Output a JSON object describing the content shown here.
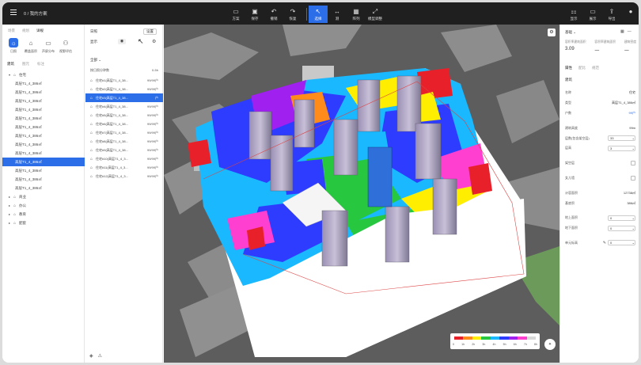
{
  "app": {
    "crumb": "0 / 我的方案"
  },
  "toolbar": {
    "groups": [
      {
        "items": [
          {
            "icon": "folder-icon",
            "glyph": "▭",
            "label": "方案"
          },
          {
            "icon": "save-icon",
            "glyph": "▣",
            "label": "保存"
          },
          {
            "icon": "undo-icon",
            "glyph": "↶",
            "label": "撤销"
          },
          {
            "icon": "redo-icon",
            "glyph": "↷",
            "label": "恢复"
          }
        ]
      },
      {
        "items": [
          {
            "icon": "cursor-icon",
            "glyph": "↖",
            "label": "选择",
            "active": true
          },
          {
            "icon": "measure-icon",
            "glyph": "↔",
            "label": "测"
          },
          {
            "icon": "array-icon",
            "glyph": "▦",
            "label": "阵列"
          },
          {
            "icon": "scale-icon",
            "glyph": "⤢",
            "label": "模型调整"
          }
        ]
      }
    ],
    "right": [
      {
        "icon": "display-icon",
        "glyph": "⚏",
        "label": "显示"
      },
      {
        "icon": "monitor-icon",
        "glyph": "▭",
        "label": "展示"
      },
      {
        "icon": "export-icon",
        "glyph": "⇪",
        "label": "导出"
      },
      {
        "icon": "user-icon",
        "glyph": "●",
        "label": ""
      }
    ]
  },
  "left": {
    "tabs": [
      "场景",
      "规划",
      "详规"
    ],
    "modes": [
      {
        "label": "日照",
        "icon": "sun-icon",
        "glyph": "☼",
        "active": true
      },
      {
        "label": "覆盖面积",
        "icon": "building-icon",
        "glyph": "⌂"
      },
      {
        "label": "声屏分布",
        "icon": "folder-icon",
        "glyph": "▭"
      },
      {
        "label": "视野评估",
        "icon": "view-icon",
        "glyph": "⚇"
      }
    ],
    "subtabs": [
      "建筑",
      "图元",
      "标注"
    ],
    "tree": [
      {
        "type": "group",
        "label": "住宅",
        "open": true
      },
      {
        "type": "item",
        "label": "高层T1_4_386㎡"
      },
      {
        "type": "item",
        "label": "高层T1_4_386㎡"
      },
      {
        "type": "item",
        "label": "高层T1_4_386㎡"
      },
      {
        "type": "item",
        "label": "高层T1_4_386㎡"
      },
      {
        "type": "item",
        "label": "高层T1_4_386㎡"
      },
      {
        "type": "item",
        "label": "高层T1_4_386㎡"
      },
      {
        "type": "item",
        "label": "高层T1_4_386㎡"
      },
      {
        "type": "item",
        "label": "高层T1_4_386㎡"
      },
      {
        "type": "item",
        "label": "高层T1_4_386㎡"
      },
      {
        "type": "item",
        "label": "高层T1_4_386㎡",
        "selected": true
      },
      {
        "type": "item",
        "label": "高层T1_4_386㎡"
      },
      {
        "type": "item",
        "label": "高层T1_4_386㎡"
      },
      {
        "type": "item",
        "label": "高层T1_4_386㎡"
      },
      {
        "type": "group",
        "label": "商业"
      },
      {
        "type": "group",
        "label": "办公"
      },
      {
        "type": "group",
        "label": "教育"
      },
      {
        "type": "group",
        "label": "配套"
      }
    ]
  },
  "middle": {
    "title": "日照",
    "reset_label": "设置",
    "display_label": "显示",
    "filter_label": "全部",
    "col_left": "按日照分钟数",
    "col_right": "0-5h",
    "rows": [
      {
        "name": "住宅#1(高层T1_4_38...",
        "value": "99/99户"
      },
      {
        "name": "住宅#2(高层T1_4_38...",
        "value": "99/99户"
      },
      {
        "name": "住宅#3(高层T1_4_38...",
        "value": "户",
        "selected": true
      },
      {
        "name": "住宅#4(高层T1_4_38...",
        "value": "99/99户"
      },
      {
        "name": "住宅#5(高层T1_4_38...",
        "value": "99/99户"
      },
      {
        "name": "住宅#6(高层T1_4_38...",
        "value": "99/99户"
      },
      {
        "name": "住宅#7(高层T1_4_38...",
        "value": "99/99户"
      },
      {
        "name": "住宅#8(高层T1_4_38...",
        "value": "99/99户"
      },
      {
        "name": "住宅#9(高层T1_4_38...",
        "value": "99/99户"
      },
      {
        "name": "住宅#10(高层T1_4_3...",
        "value": "99/99户"
      },
      {
        "name": "住宅#11(高层T1_4_3...",
        "value": "99/99户"
      },
      {
        "name": "住宅#12(高层T1_4_3...",
        "value": "99/99户"
      }
    ]
  },
  "viewport": {
    "legend_colors": [
      "#e8202a",
      "#ff8c1a",
      "#ffee00",
      "#27c840",
      "#19b8ff",
      "#2e3cff",
      "#a020f0",
      "#ff3fd0",
      "#d9d9d9"
    ],
    "legend_ticks": [
      "0",
      "1h",
      "2h",
      "3h",
      "4h",
      "5h",
      "6h",
      "7h",
      "8h"
    ]
  },
  "right": {
    "header": "基础",
    "stats": [
      {
        "k": "容积率建筑面积",
        "v": "3.09"
      },
      {
        "k": "容积率建筑面积",
        "v": "一"
      },
      {
        "k": "建筑密度",
        "v": "一"
      }
    ],
    "tabs": [
      "属性",
      "配比",
      "规范"
    ],
    "section": "建筑",
    "props": [
      {
        "label": "名称",
        "value": "住宅",
        "kind": "text"
      },
      {
        "label": "类型",
        "value": "高层T1_4_386㎡",
        "kind": "text"
      },
      {
        "label": "户数",
        "value": "99户",
        "kind": "blue"
      },
      {
        "label": "",
        "value": "",
        "kind": "blank"
      },
      {
        "label": "建筑高度",
        "value": "99m",
        "kind": "text"
      },
      {
        "label": "层数(包含架空层)",
        "value": "33",
        "kind": "input"
      },
      {
        "label": "层高",
        "value": "3",
        "kind": "input"
      },
      {
        "label": "",
        "value": "",
        "kind": "blank"
      },
      {
        "label": "架空层",
        "value": "",
        "kind": "check"
      },
      {
        "label": "",
        "value": "",
        "kind": "blank"
      },
      {
        "label": "女儿墙",
        "value": "",
        "kind": "check"
      },
      {
        "label": "",
        "value": "",
        "kind": "blank"
      },
      {
        "label": "计容面积",
        "value": "12738㎡",
        "kind": "text"
      },
      {
        "label": "基底积",
        "value": "386㎡",
        "kind": "text"
      },
      {
        "label": "",
        "value": "",
        "kind": "blank"
      },
      {
        "label": "地上面积",
        "value": "0",
        "kind": "input"
      },
      {
        "label": "地下面积",
        "value": "0",
        "kind": "input"
      },
      {
        "label": "",
        "value": "",
        "kind": "blank"
      },
      {
        "label": "单元标高",
        "value": "0",
        "kind": "pencil-input"
      }
    ]
  }
}
